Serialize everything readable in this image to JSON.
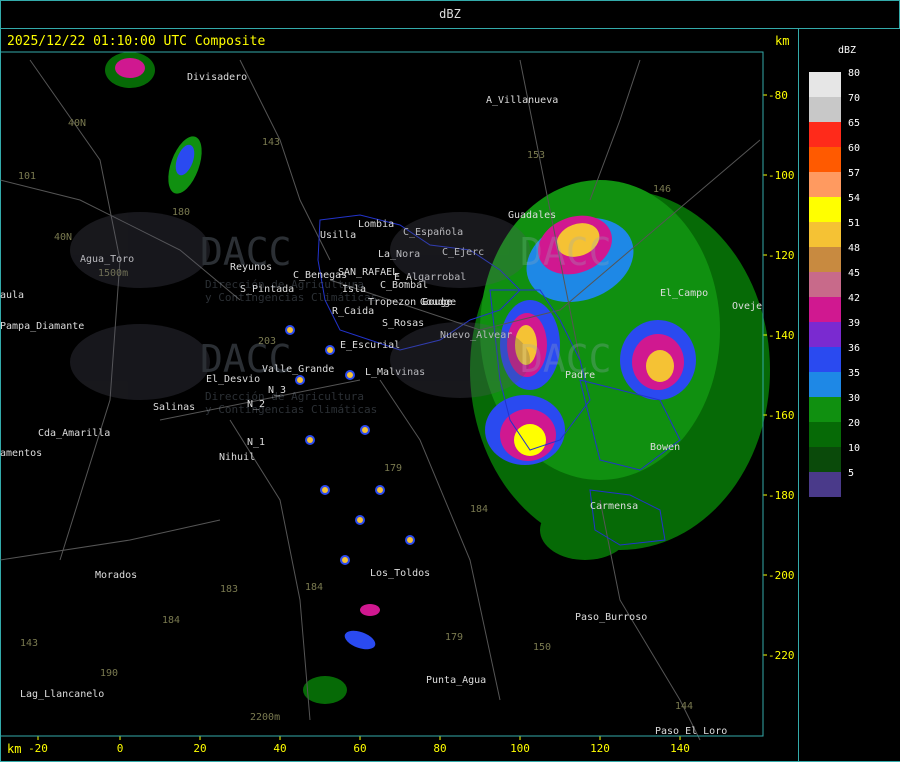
{
  "window": {
    "title": "dBZ"
  },
  "header": {
    "timestamp_text": "2025/12/22 01:10:00 UTC Composite",
    "km_label": "km"
  },
  "axes": {
    "x_unit": "km",
    "x_ticks": [
      "-20",
      "0",
      "20",
      "40",
      "60",
      "80",
      "100",
      "120",
      "140"
    ],
    "y_unit": "km",
    "y_ticks": [
      "-80",
      "-100",
      "-120",
      "-140",
      "-160",
      "-180",
      "-200",
      "-220"
    ]
  },
  "colorbar": {
    "title": "dBZ",
    "levels": [
      {
        "label": "80",
        "color": "#e6e6e6"
      },
      {
        "label": "70",
        "color": "#c8c8c8"
      },
      {
        "label": "65",
        "color": "#ff2a1a"
      },
      {
        "label": "60",
        "color": "#ff5a00"
      },
      {
        "label": "57",
        "color": "#ff9a60"
      },
      {
        "label": "54",
        "color": "#ffff00"
      },
      {
        "label": "51",
        "color": "#f5c234"
      },
      {
        "label": "48",
        "color": "#c88a40"
      },
      {
        "label": "45",
        "color": "#c86a8a"
      },
      {
        "label": "42",
        "color": "#d01890"
      },
      {
        "label": "39",
        "color": "#7a2ad0"
      },
      {
        "label": "36",
        "color": "#2a4af0"
      },
      {
        "label": "35",
        "color": "#1e88e6"
      },
      {
        "label": "30",
        "color": "#109010"
      },
      {
        "label": "20",
        "color": "#066a06"
      },
      {
        "label": "10",
        "color": "#0a4a0a"
      },
      {
        "label": "5",
        "color": "#4a3a8a"
      }
    ]
  },
  "places": [
    {
      "name": "Divisadero"
    },
    {
      "name": "A_Villanueva"
    },
    {
      "name": "Usilla"
    },
    {
      "name": "Lombia"
    },
    {
      "name": "C_Española"
    },
    {
      "name": "C_Ejerc"
    },
    {
      "name": "Guadales"
    },
    {
      "name": "La_Nora"
    },
    {
      "name": "Agua_Toro"
    },
    {
      "name": "Reyunos"
    },
    {
      "name": "C_Benegas"
    },
    {
      "name": "SAN_RAFAEL"
    },
    {
      "name": "E_Algarrobal"
    },
    {
      "name": "C_Bombal"
    },
    {
      "name": "S_Pintada"
    },
    {
      "name": "Isla"
    },
    {
      "name": "Tropezon Gouge"
    },
    {
      "name": "R_Caida"
    },
    {
      "name": "aula"
    },
    {
      "name": "Pampa_Diamante"
    },
    {
      "name": "S_Rosas"
    },
    {
      "name": "E_Escurial"
    },
    {
      "name": "Valle_Grande"
    },
    {
      "name": "L_Malvinas"
    },
    {
      "name": "El_Desvio"
    },
    {
      "name": "Salinas"
    },
    {
      "name": "N_3"
    },
    {
      "name": "N_2"
    },
    {
      "name": "N_1"
    },
    {
      "name": "Cda_Amarilla"
    },
    {
      "name": "amentos"
    },
    {
      "name": "Nihuil"
    },
    {
      "name": "Morados"
    },
    {
      "name": "Los_Toldos"
    },
    {
      "name": "Paso_Burroso"
    },
    {
      "name": "Punta_Agua"
    },
    {
      "name": "Lag_Llancanelo"
    },
    {
      "name": "Paso_El_Loro"
    },
    {
      "name": "Carmensa"
    },
    {
      "name": "Bowen"
    },
    {
      "name": "Goudge"
    },
    {
      "name": "Nuevo_Alvear"
    },
    {
      "name": "El_Campo"
    },
    {
      "name": "Oveje"
    },
    {
      "name": "Padre"
    }
  ],
  "route_numbers": [
    "143",
    "153",
    "146",
    "101",
    "40N",
    "40N",
    "180",
    "184",
    "179",
    "150",
    "179",
    "184",
    "183",
    "184",
    "190",
    "143",
    "144",
    "203"
  ],
  "elevations": [
    "1500m",
    "2200m"
  ],
  "watermark": {
    "brand": "DACC",
    "line1": "Dirección de Agricultura",
    "line2": "y Contingencias Climáticas"
  }
}
